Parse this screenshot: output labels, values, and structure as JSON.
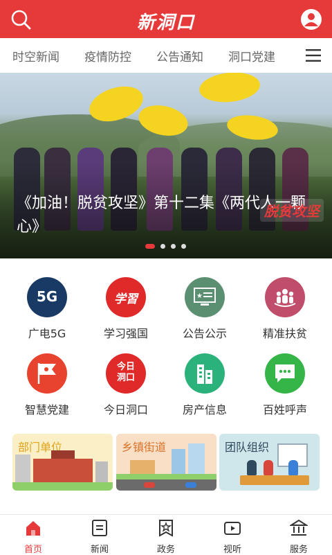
{
  "header": {
    "logo": "新洞口",
    "search_icon": "search-icon",
    "profile_icon": "user-icon",
    "color": "#e63a3a"
  },
  "tabs": [
    "时空新闻",
    "疫情防控",
    "公告通知",
    "洞口党建"
  ],
  "banner": {
    "caption": "《加油！脱贫攻坚》第十二集《两代人一颗心》",
    "badge": "脱贫攻坚",
    "active_dot": 0,
    "dot_count": 4
  },
  "grid": [
    {
      "label": "广电5G",
      "icon": "5g-icon",
      "icon_text": "5G",
      "color": "#1a3a66"
    },
    {
      "label": "学习强国",
      "icon": "xuexi-icon",
      "icon_text": "学習",
      "color": "#e02a2a"
    },
    {
      "label": "公告公示",
      "icon": "notice-board-icon",
      "icon_text": "",
      "color": "#5a8f72"
    },
    {
      "label": "精准扶贫",
      "icon": "people-icon",
      "icon_text": "",
      "color": "#c04d6a"
    },
    {
      "label": "智慧党建",
      "icon": "party-flag-icon",
      "icon_text": "",
      "color": "#e8432e"
    },
    {
      "label": "今日洞口",
      "icon": "today-dongkou-icon",
      "icon_text": "今日洞口",
      "color": "#e02a2a"
    },
    {
      "label": "房产信息",
      "icon": "building-icon",
      "icon_text": "",
      "color": "#2ab27a"
    },
    {
      "label": "百姓呼声",
      "icon": "chat-icon",
      "icon_text": "",
      "color": "#35b548"
    }
  ],
  "cards": [
    {
      "title": "部门单位",
      "color": "#f3c12c",
      "bg": "#fbefc8"
    },
    {
      "title": "乡镇街道",
      "color": "#d9732a",
      "bg": "#f8dfc6"
    },
    {
      "title": "团队组织",
      "color": "#2f4a5e",
      "bg": "#cfe6ea"
    }
  ],
  "nav": [
    {
      "label": "首页",
      "icon": "home-icon",
      "active": true
    },
    {
      "label": "新闻",
      "icon": "news-icon",
      "active": false
    },
    {
      "label": "政务",
      "icon": "government-icon",
      "active": false
    },
    {
      "label": "视听",
      "icon": "video-icon",
      "active": false
    },
    {
      "label": "服务",
      "icon": "service-icon",
      "active": false
    }
  ]
}
